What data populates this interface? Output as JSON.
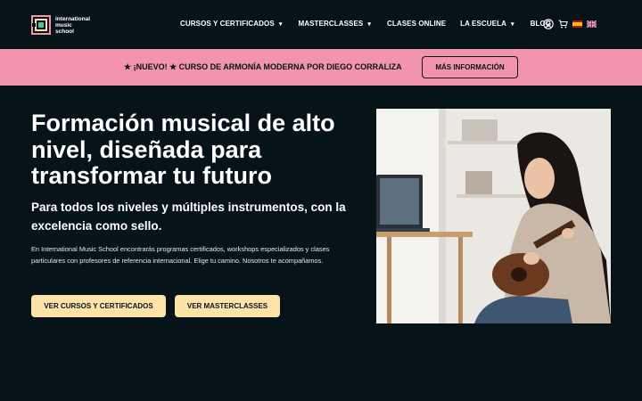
{
  "brand": {
    "name_lines": [
      "international",
      "music",
      "school"
    ],
    "colors": {
      "background": "#06141a",
      "banner": "#f394ae",
      "cta": "#fde3a8"
    }
  },
  "nav": {
    "items": [
      {
        "label": "CURSOS Y CERTIFICADOS",
        "dropdown": true
      },
      {
        "label": "MASTERCLASSES",
        "dropdown": true
      },
      {
        "label": "CLASES ONLINE",
        "dropdown": false
      },
      {
        "label": "LA ESCUELA",
        "dropdown": true
      },
      {
        "label": "BLOG",
        "dropdown": false
      }
    ],
    "icons": [
      "user-icon",
      "cart-icon",
      "flag-es-icon",
      "flag-uk-icon"
    ]
  },
  "banner": {
    "text": "★ ¡NUEVO! ★ CURSO DE ARMONÍA MODERNA POR DIEGO CORRALIZA",
    "button": "MÁS INFORMACIÓN"
  },
  "hero": {
    "title": "Formación musical de alto nivel, diseñada para transformar tu futuro",
    "subtitle": "Para todos los niveles y múltiples instrumentos, con la excelencia como sello.",
    "body": "En International Music School encontrarás programas certificados, workshops especializados y clases particulares con profesores de referencia internacional. Elige tu camino. Nosotros te acompañamos.",
    "buttons": [
      "VER CURSOS Y CERTIFICADOS",
      "VER MASTERCLASSES"
    ]
  }
}
